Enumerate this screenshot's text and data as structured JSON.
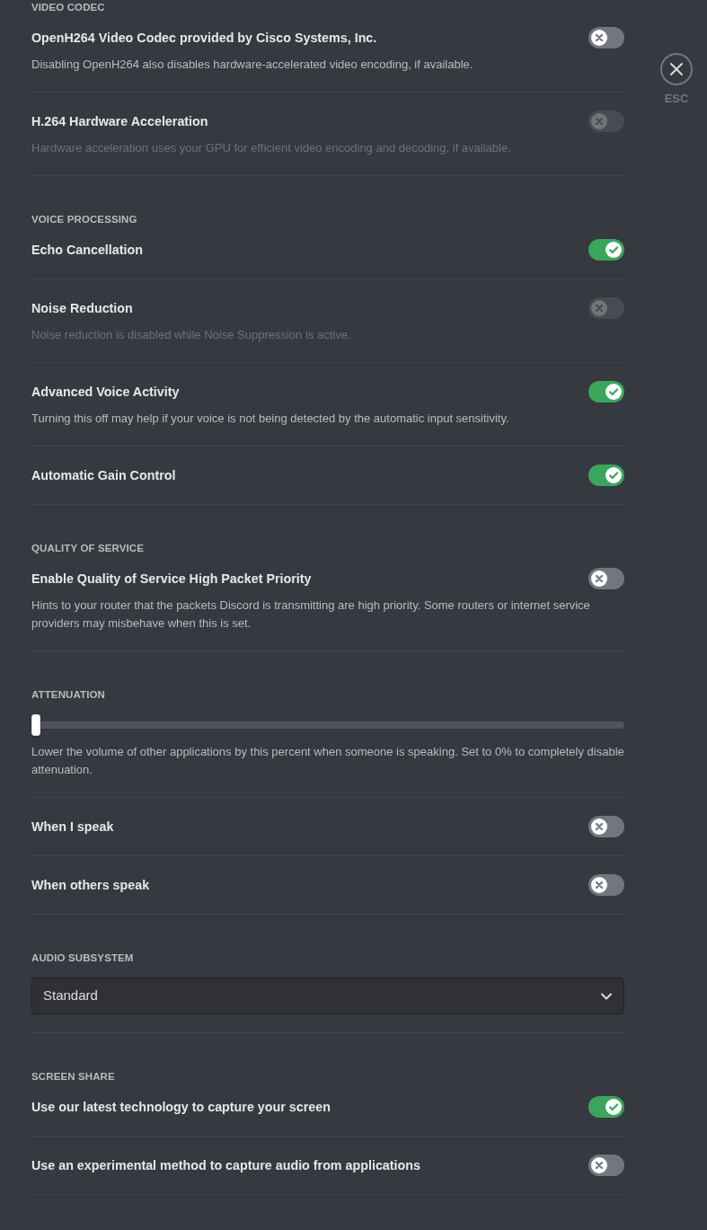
{
  "sections": [
    {
      "heading": "VIDEO CODEC",
      "items": [
        {
          "kind": "toggle",
          "title": "OpenH264 Video Codec provided by Cisco Systems, Inc.",
          "note": "Disabling OpenH264 also disables hardware-accelerated video encoding, if available.",
          "on": false,
          "disabled": false
        },
        {
          "kind": "toggle",
          "title": "H.264 Hardware Acceleration",
          "note": "Hardware acceleration uses your GPU for efficient video encoding and decoding, if available.",
          "on": false,
          "disabled": true
        }
      ]
    },
    {
      "heading": "VOICE PROCESSING",
      "items": [
        {
          "kind": "toggle",
          "title": "Echo Cancellation",
          "on": true,
          "disabled": false
        },
        {
          "kind": "toggle",
          "title": "Noise Reduction",
          "note": "Noise reduction is disabled while Noise Suppression is active.",
          "on": false,
          "disabled": true
        },
        {
          "kind": "toggle",
          "title": "Advanced Voice Activity",
          "note": "Turning this off may help if your voice is not being detected by the automatic input sensitivity.",
          "on": true,
          "disabled": false
        },
        {
          "kind": "toggle",
          "title": "Automatic Gain Control",
          "on": true,
          "disabled": false
        }
      ]
    },
    {
      "heading": "QUALITY OF SERVICE",
      "items": [
        {
          "kind": "toggle",
          "title": "Enable Quality of Service High Packet Priority",
          "note": "Hints to your router that the packets Discord is transmitting are high priority. Some routers or internet service providers may misbehave when this is set.",
          "on": false,
          "disabled": false
        }
      ]
    },
    {
      "heading": "ATTENUATION",
      "items": [
        {
          "kind": "slider",
          "level": 0,
          "note": "Lower the volume of other applications by this percent when someone is speaking. Set to 0% to completely disable attenuation."
        },
        {
          "kind": "toggle",
          "title": "When I speak",
          "on": false,
          "disabled": false
        },
        {
          "kind": "toggle",
          "title": "When others speak",
          "on": false,
          "disabled": false
        }
      ]
    },
    {
      "heading": "AUDIO SUBSYSTEM",
      "items": [
        {
          "kind": "select",
          "value": "Standard"
        }
      ]
    },
    {
      "heading": "SCREEN SHARE",
      "items": [
        {
          "kind": "toggle",
          "title": "Use our latest technology to capture your screen",
          "on": true,
          "disabled": false
        },
        {
          "kind": "toggle",
          "title": "Use an experimental method to capture audio from applications",
          "on": false,
          "disabled": false
        }
      ]
    }
  ],
  "close": {
    "label": "ESC"
  }
}
